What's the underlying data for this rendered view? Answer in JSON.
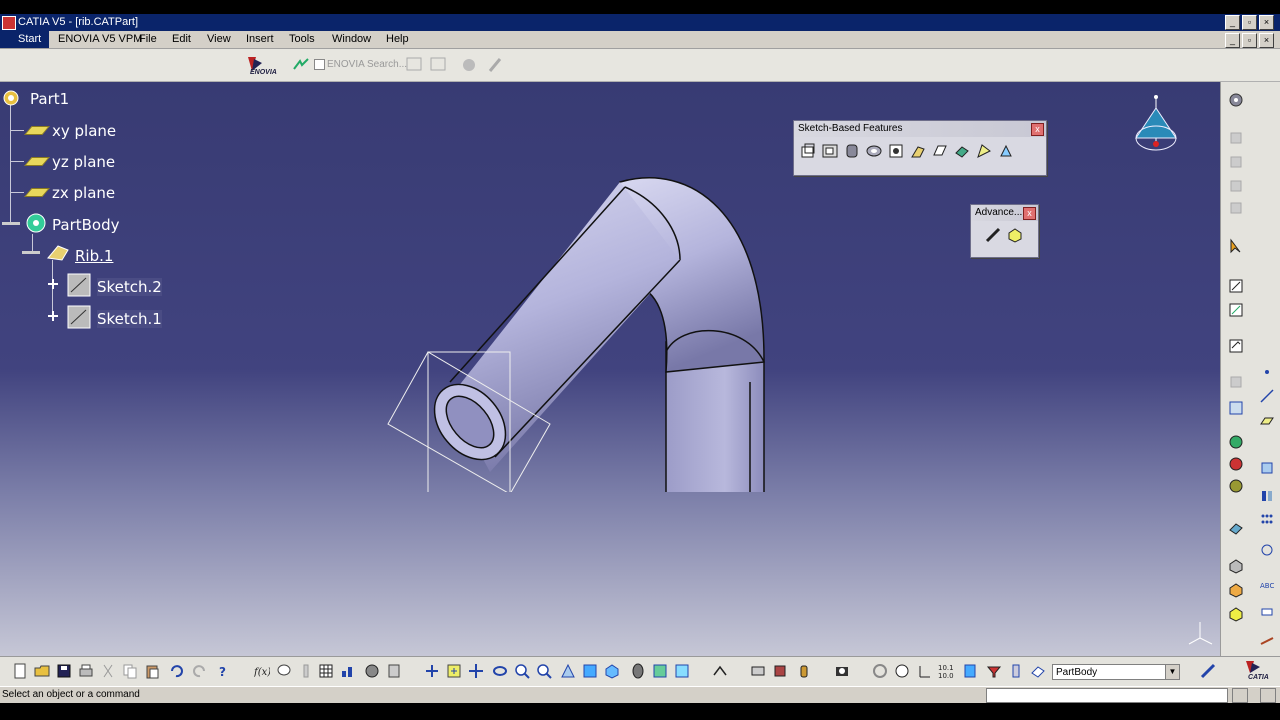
{
  "window": {
    "title": "CATIA V5 - [rib.CATPart]"
  },
  "menu": {
    "start": "Start",
    "items": [
      "ENOVIA V5 VPM",
      "File",
      "Edit",
      "View",
      "Insert",
      "Tools",
      "Window",
      "Help"
    ]
  },
  "toolbar": {
    "enovia_label": "ENOVIA",
    "search_placeholder": "ENOVIA Search..."
  },
  "tree": {
    "root": "Part1",
    "planes": [
      "xy plane",
      "yz plane",
      "zx plane"
    ],
    "body": "PartBody",
    "feature": "Rib.1",
    "sketches": [
      "Sketch.2",
      "Sketch.1"
    ]
  },
  "sketch_based_features": {
    "title": "Sketch-Based Features",
    "close": "x"
  },
  "advanced": {
    "title": "Advance...",
    "close": "x"
  },
  "bottom": {
    "current_body": "PartBody",
    "catia_logo": "CATIA"
  },
  "status": {
    "message": "Select an object or a command"
  },
  "colors": {
    "viewport_top": "#383b73",
    "viewport_bottom": "#c6c7d6",
    "part_fill": "#b4b4dc",
    "titlebar": "#0a246a"
  }
}
